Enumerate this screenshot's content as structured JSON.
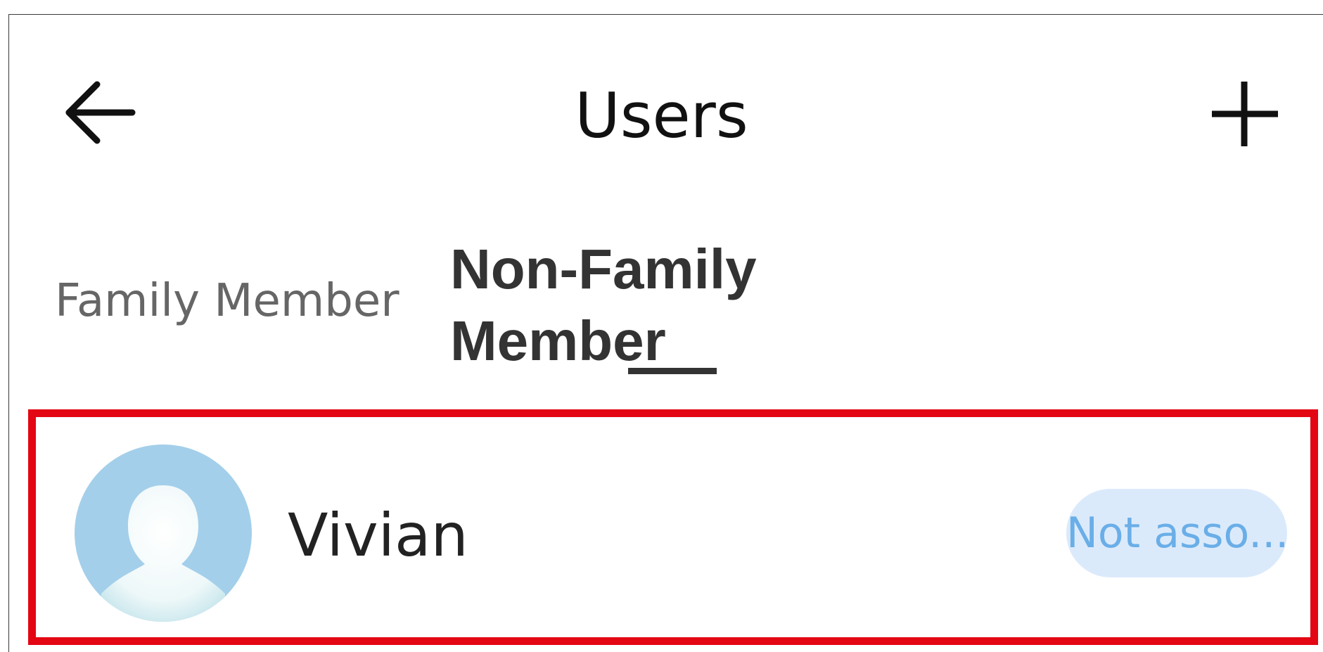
{
  "header": {
    "title": "Users",
    "back_icon": "arrow-left-icon",
    "add_icon": "plus-icon"
  },
  "tabs": [
    {
      "label": "Family Member",
      "selected": false
    },
    {
      "label": "Non-Family Member",
      "selected": true
    }
  ],
  "users": [
    {
      "name": "Vivian",
      "status": "Not asso...",
      "avatar_icon": "default-avatar-icon",
      "highlighted": true
    }
  ],
  "colors": {
    "highlight_border": "#e30613",
    "status_bg": "#dbeafb",
    "status_text": "#6aaee8",
    "avatar_bg": "#a3cfea"
  }
}
